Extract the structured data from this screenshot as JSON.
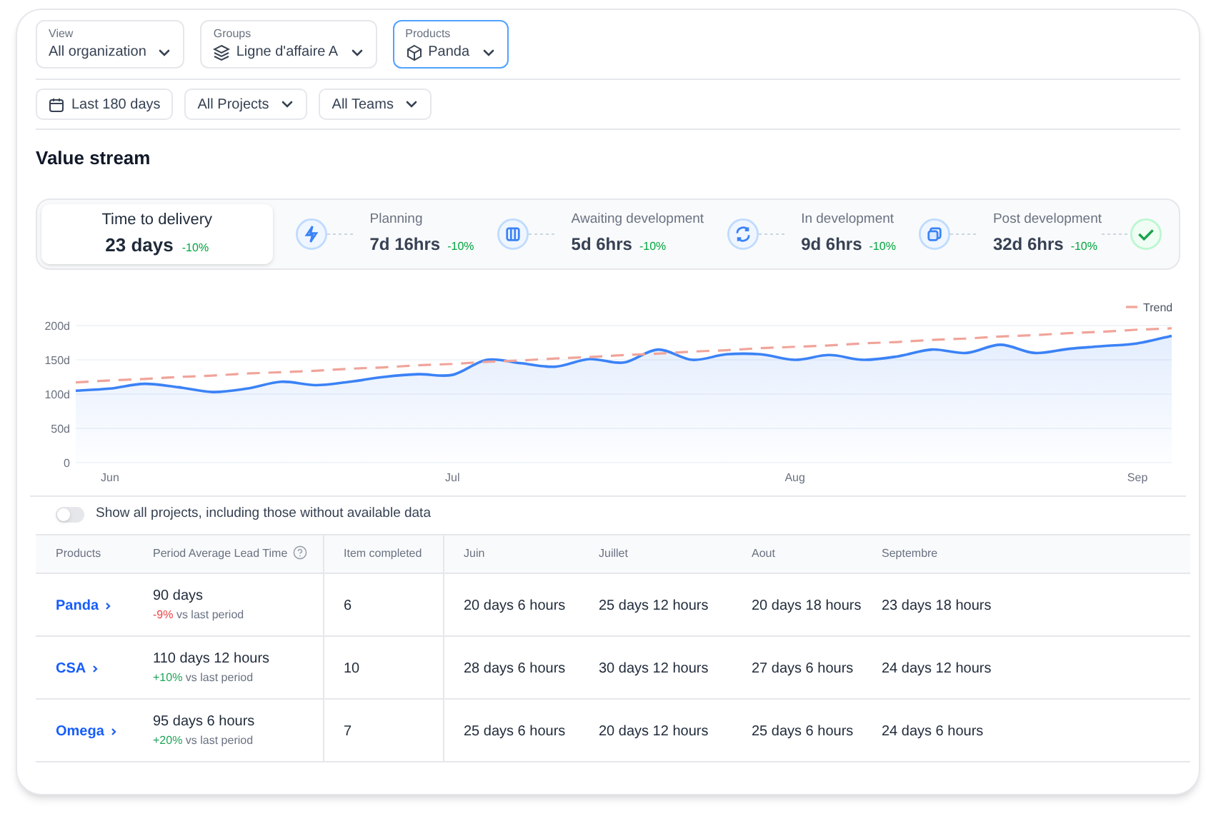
{
  "filters": [
    {
      "label": "View",
      "value": "All organization",
      "selected": false
    },
    {
      "label": "Groups",
      "value": "Ligne d'affaire A",
      "selected": false
    },
    {
      "label": "Products",
      "value": "Panda",
      "selected": true
    }
  ],
  "quick_filters": [
    "Last 180 days",
    "All Projects",
    "All Teams"
  ],
  "section_title": "Value stream",
  "summary": {
    "label": "Time to delivery",
    "value": "23 days",
    "change": "-10%"
  },
  "stages": [
    {
      "label": "Planning",
      "value": "7d 16hrs",
      "change": "-10%"
    },
    {
      "label": "Awaiting development",
      "value": "5d 6hrs",
      "change": "-10%"
    },
    {
      "label": "In development",
      "value": "9d 6hrs",
      "change": "-10%"
    },
    {
      "label": "Post development",
      "value": "32d 6hrs",
      "change": "-10%"
    }
  ],
  "chart": {
    "chart_data": {
      "type": "line",
      "categories": [
        null,
        "Jun",
        null,
        null,
        null,
        null,
        null,
        null,
        null,
        null,
        null,
        "Jul",
        null,
        null,
        null,
        null,
        null,
        null,
        null,
        null,
        null,
        "Aug",
        null,
        null,
        null,
        null,
        null,
        null,
        null,
        null,
        null,
        "Sep",
        null
      ],
      "series": [
        {
          "type": "area",
          "color": "#3b82f6",
          "values": [
            105,
            108,
            115,
            110,
            103,
            108,
            118,
            113,
            118,
            125,
            129,
            128,
            150,
            145,
            140,
            151,
            146,
            165,
            150,
            158,
            158,
            150,
            157,
            150,
            155,
            165,
            160,
            172,
            160,
            166,
            170,
            174,
            185
          ]
        },
        {
          "name": "Trend",
          "type": "line",
          "line_style": "dashed",
          "color": "#f0a49a",
          "values": [
            117,
            120,
            122,
            125,
            127,
            130,
            132,
            134,
            137,
            139,
            142,
            144,
            147,
            149,
            152,
            154,
            157,
            159,
            162,
            164,
            167,
            169,
            171,
            174,
            176,
            179,
            181,
            184,
            186,
            189,
            191,
            194,
            196
          ]
        }
      ],
      "ylim": [
        0,
        200
      ],
      "grid": true,
      "yticks": [
        0,
        {
          "value": 50,
          "label": "50d"
        },
        {
          "value": 100,
          "label": "100d"
        },
        {
          "value": 150,
          "label": "150d"
        },
        {
          "value": 200,
          "label": "200d"
        }
      ]
    }
  },
  "toggle": {
    "label": "Show all projects, including those without available data",
    "on": false
  },
  "table": {
    "columns": [
      "Products",
      "Period Average Lead Time",
      "Item completed",
      "Juin",
      "Juillet",
      "Aout",
      "Septembre"
    ],
    "rows": [
      {
        "product": "Panda",
        "lead_time": "90 days",
        "change": "-9%",
        "color": "#ef4444",
        "note": "vs last period",
        "items": "6",
        "months": [
          "20 days 6 hours",
          "25 days 12 hours",
          "20 days 18 hours",
          "23 days 18 hours"
        ]
      },
      {
        "product": "CSA",
        "lead_time": "110 days 12 hours",
        "change": "+10%",
        "color": "#22a55a",
        "note": "vs last period",
        "items": "10",
        "months": [
          "28 days 6 hours",
          "30 days 12 hours",
          "27 days 6 hours",
          "24 days 12 hours"
        ]
      },
      {
        "product": "Omega",
        "lead_time": "95 days 6 hours",
        "change": "+20%",
        "color": "#22a55a",
        "note": "vs last period",
        "items": "7",
        "months": [
          "25 days 6 hours",
          "20 days 12 hours",
          "25 days 6 hours",
          "24 days 6 hours"
        ]
      }
    ]
  }
}
